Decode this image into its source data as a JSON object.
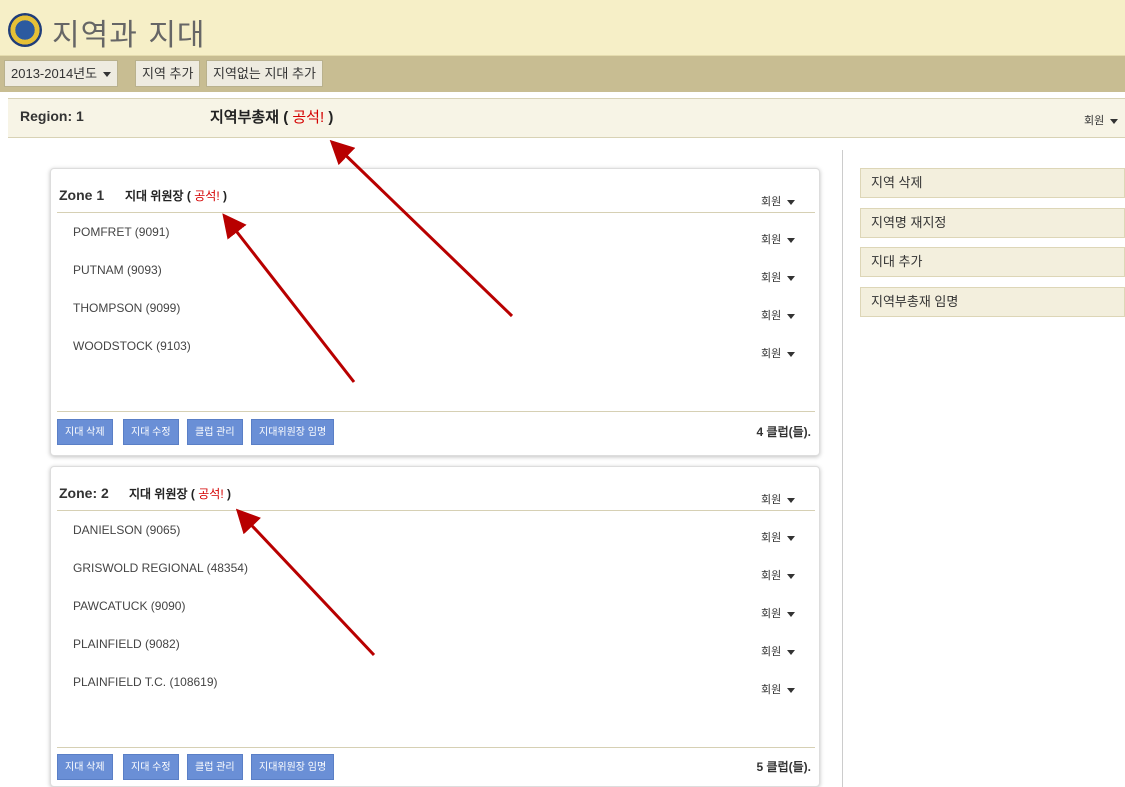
{
  "header": {
    "title": "지역과 지대"
  },
  "toolbar": {
    "year_select": "2013-2014년도",
    "add_region": "지역 추가",
    "add_zone_without_region": "지역없는 지대 추가"
  },
  "region": {
    "label": "Region: 1",
    "governor_title": "지역부총재",
    "paren_open": "(",
    "vacant": "공석!",
    "paren_close": ")",
    "member_dropdown": "회원"
  },
  "zones": [
    {
      "name": "Zone 1",
      "chair_title": "지대 위원장",
      "paren_open": "(",
      "vacant": "공석!",
      "paren_close": ")",
      "member_dropdown": "회원",
      "clubs": [
        {
          "name": "POMFRET (9091)",
          "member_dropdown": "회원"
        },
        {
          "name": "PUTNAM (9093)",
          "member_dropdown": "회원"
        },
        {
          "name": "THOMPSON (9099)",
          "member_dropdown": "회원"
        },
        {
          "name": "WOODSTOCK (9103)",
          "member_dropdown": "회원"
        }
      ],
      "actions": {
        "delete": "지대 삭제",
        "edit": "지대 수정",
        "manage_clubs": "클럽 관리",
        "appoint_chair": "지대위원장 임명"
      },
      "club_count": "4 클럽(들)."
    },
    {
      "name": "Zone: 2",
      "chair_title": "지대 위원장",
      "paren_open": "(",
      "vacant": "공석!",
      "paren_close": ")",
      "member_dropdown": "회원",
      "clubs": [
        {
          "name": "DANIELSON (9065)",
          "member_dropdown": "회원"
        },
        {
          "name": "GRISWOLD REGIONAL (48354)",
          "member_dropdown": "회원"
        },
        {
          "name": "PAWCATUCK (9090)",
          "member_dropdown": "회원"
        },
        {
          "name": "PLAINFIELD (9082)",
          "member_dropdown": "회원"
        },
        {
          "name": "PLAINFIELD T.C. (108619)",
          "member_dropdown": "회원"
        }
      ],
      "actions": {
        "delete": "지대 삭제",
        "edit": "지대 수정",
        "manage_clubs": "클럽 관리",
        "appoint_chair": "지대위원장 임명"
      },
      "club_count": "5 클럽(들)."
    }
  ],
  "sidebar": {
    "items": [
      {
        "label": "지역 삭제"
      },
      {
        "label": "지역명 재지정"
      },
      {
        "label": "지대 추가"
      },
      {
        "label": "지역부총재 임명"
      }
    ]
  },
  "colors": {
    "accent_button": "#6a8fd6",
    "vacant_text": "#d40000",
    "arrow": "#b80000",
    "header_bg": "#f6efc7",
    "toolbar_bg": "#c8bd92"
  },
  "icons": [
    "lions-logo-icon",
    "caret-down-icon"
  ]
}
